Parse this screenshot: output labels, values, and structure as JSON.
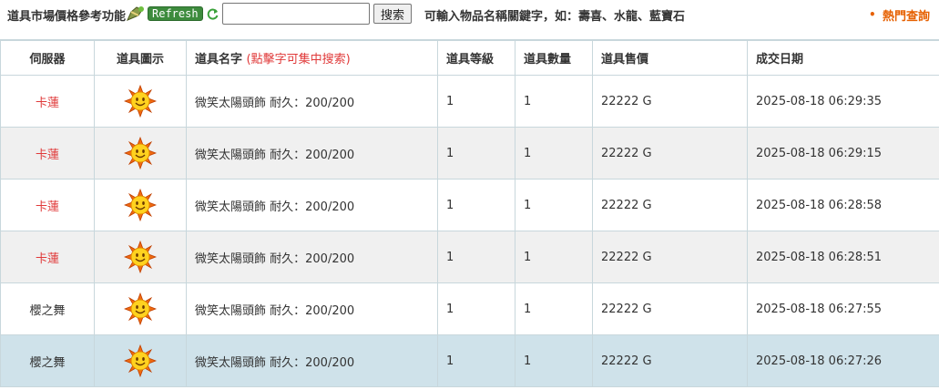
{
  "toolbar": {
    "title": "道具市場價格參考功能",
    "refresh_label": "Refresh",
    "search_value": "",
    "search_button": "搜索",
    "hint": "可輸入物品名稱關鍵字，如：壽喜、水龍、藍寶石",
    "hot_marker": "•",
    "hot_link": "熱門查詢"
  },
  "table": {
    "headers": {
      "server": "伺服器",
      "icon": "道具圖示",
      "name": "道具名字",
      "name_hint": "(點擊字可集中搜索)",
      "level": "道具等級",
      "quantity": "道具數量",
      "price": "道具售價",
      "date": "成交日期"
    },
    "rows": [
      {
        "server": "卡蓮",
        "icon": "sun-icon",
        "name": "微笑太陽頭飾 耐久：200/200",
        "level": "1",
        "quantity": "1",
        "price": "22222 G",
        "date": "2025-08-18 06:29:35"
      },
      {
        "server": "卡蓮",
        "icon": "sun-icon",
        "name": "微笑太陽頭飾 耐久：200/200",
        "level": "1",
        "quantity": "1",
        "price": "22222 G",
        "date": "2025-08-18 06:29:15"
      },
      {
        "server": "卡蓮",
        "icon": "sun-icon",
        "name": "微笑太陽頭飾 耐久：200/200",
        "level": "1",
        "quantity": "1",
        "price": "22222 G",
        "date": "2025-08-18 06:28:58"
      },
      {
        "server": "卡蓮",
        "icon": "sun-icon",
        "name": "微笑太陽頭飾 耐久：200/200",
        "level": "1",
        "quantity": "1",
        "price": "22222 G",
        "date": "2025-08-18 06:28:51"
      },
      {
        "server": "櫻之舞",
        "icon": "sun-icon",
        "name": "微笑太陽頭飾 耐久：200/200",
        "level": "1",
        "quantity": "1",
        "price": "22222 G",
        "date": "2025-08-18 06:27:55"
      },
      {
        "server": "櫻之舞",
        "icon": "sun-icon",
        "name": "微笑太陽頭飾 耐久：200/200",
        "level": "1",
        "quantity": "1",
        "price": "22222 G",
        "date": "2025-08-18 06:27:26"
      }
    ]
  }
}
